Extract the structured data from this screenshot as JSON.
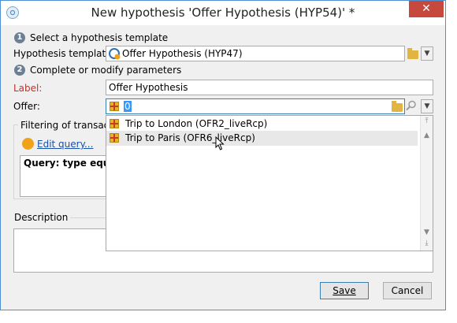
{
  "window": {
    "title": "New hypothesis 'Offer Hypothesis (HYP54)' *",
    "close_glyph": "✕"
  },
  "step1": {
    "number": "1",
    "label": "Select a hypothesis template"
  },
  "template": {
    "label": "Hypothesis template:",
    "value": "Offer Hypothesis (HYP47)",
    "icon": "hypothesis-icon"
  },
  "step2": {
    "number": "2",
    "label": "Complete or modify parameters"
  },
  "label_field": {
    "label": "Label:",
    "value": "Offer Hypothesis"
  },
  "offer": {
    "label": "Offer:",
    "value": "0",
    "icon": "gift-icon"
  },
  "filtering": {
    "legend": "Filtering of transactio",
    "edit_link": "Edit query...",
    "query_text": "Query: type equal t"
  },
  "dropdown": {
    "items": [
      {
        "label": "Trip to London (OFR2_liveRcp)",
        "icon": "gift-icon"
      },
      {
        "label": "Trip to Paris (OFR6_liveRcp)",
        "icon": "gift-icon"
      }
    ]
  },
  "description": {
    "label": "Description"
  },
  "buttons": {
    "save": "Save",
    "cancel": "Cancel"
  }
}
